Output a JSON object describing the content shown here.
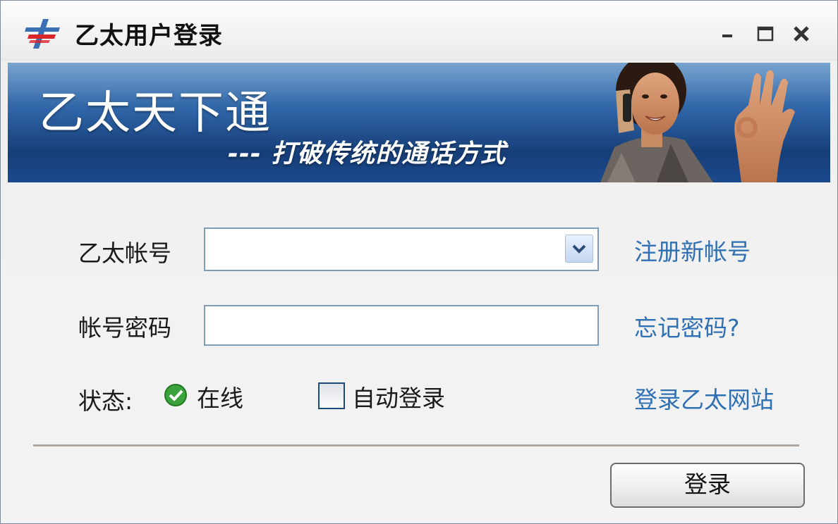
{
  "window": {
    "title": "乙太用户登录",
    "controls": {
      "minimize": "minimize-icon",
      "maximize": "maximize-icon",
      "close": "close-icon"
    }
  },
  "banner": {
    "title": "乙太天下通",
    "slogan": "--- 打破传统的通话方式"
  },
  "form": {
    "account_label": "乙太帐号",
    "account_value": "",
    "password_label": "帐号密码",
    "password_value": "",
    "status_label": "状态:",
    "status_value": "在线",
    "auto_login_label": "自动登录",
    "auto_login_checked": false
  },
  "links": {
    "register": "注册新帐号",
    "forgot_password": "忘记密码?",
    "website": "登录乙太网站"
  },
  "actions": {
    "login_label": "登录"
  },
  "colors": {
    "link": "#2f6fb3",
    "banner": "#2e64a6",
    "status_online": "#3aa23a"
  }
}
